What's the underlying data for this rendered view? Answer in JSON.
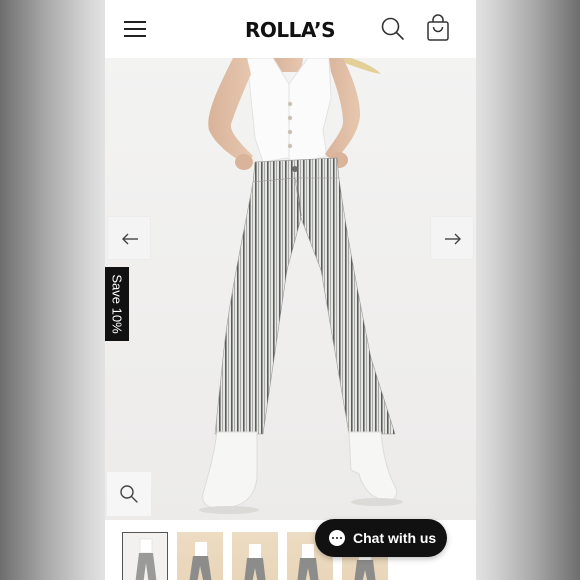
{
  "header": {
    "brand": "ROLLA’S",
    "menu_icon": "hamburger-menu-icon",
    "search_icon": "search-icon",
    "cart_icon": "shopping-bag-icon"
  },
  "gallery": {
    "prev_icon": "arrow-left-icon",
    "next_icon": "arrow-right-icon",
    "zoom_icon": "zoom-icon"
  },
  "promo": {
    "save_label": "Save 10%"
  },
  "chat": {
    "label": "Chat with us",
    "icon": "chat-bubble-icon"
  },
  "thumbnails": {
    "count_visible": 5,
    "active_index": 0
  },
  "colors": {
    "brand_black": "#111111",
    "background": "#ffffff"
  }
}
